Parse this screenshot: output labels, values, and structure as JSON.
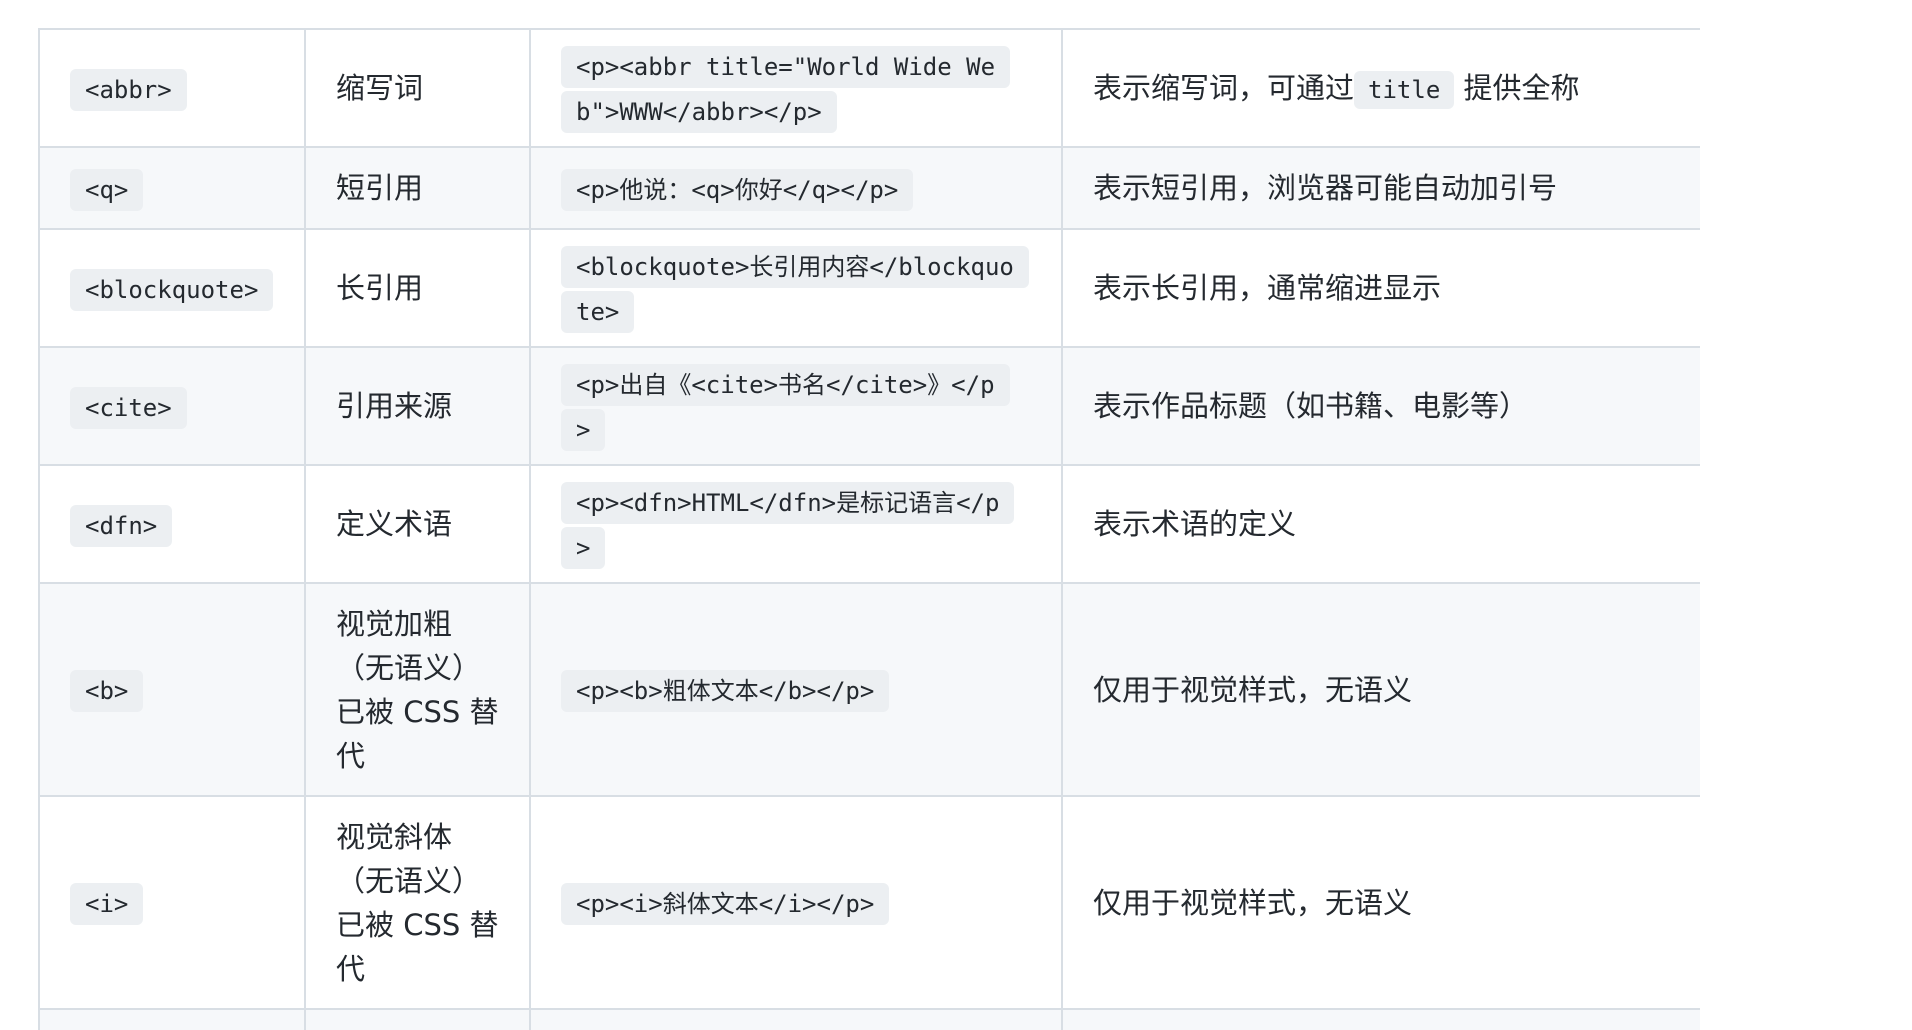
{
  "rows": [
    {
      "tag": "<abbr>",
      "name": "缩写词",
      "example": "<p><abbr title=\"World Wide Web\">WWW</abbr></p>",
      "desc_before": "表示缩写词，可通过",
      "desc_code": "title",
      "desc_after": " 提供全称"
    },
    {
      "tag": "<q>",
      "name": "短引用",
      "example": "<p>他说：<q>你好</q></p>",
      "desc": "表示短引用，浏览器可能自动加引号"
    },
    {
      "tag": "<blockquote>",
      "name": "长引用",
      "example": "<blockquote>长引用内容</blockquote>",
      "desc": "表示长引用，通常缩进显示"
    },
    {
      "tag": "<cite>",
      "name": "引用来源",
      "example": "<p>出自《<cite>书名</cite>》</p>",
      "desc": "表示作品标题（如书籍、电影等）"
    },
    {
      "tag": "<dfn>",
      "name": "定义术语",
      "example": "<p><dfn>HTML</dfn>是标记语言</p>",
      "desc": "表示术语的定义"
    },
    {
      "tag": "<b>",
      "name": "视觉加粗（无语义）已被 CSS 替代",
      "example": "<p><b>粗体文本</b></p>",
      "desc": "仅用于视觉样式，无语义"
    },
    {
      "tag": "<i>",
      "name": "视觉斜体（无语义）已被 CSS 替代",
      "example": "<p><i>斜体文本</i></p>",
      "desc": "仅用于视觉样式，无语义"
    }
  ]
}
